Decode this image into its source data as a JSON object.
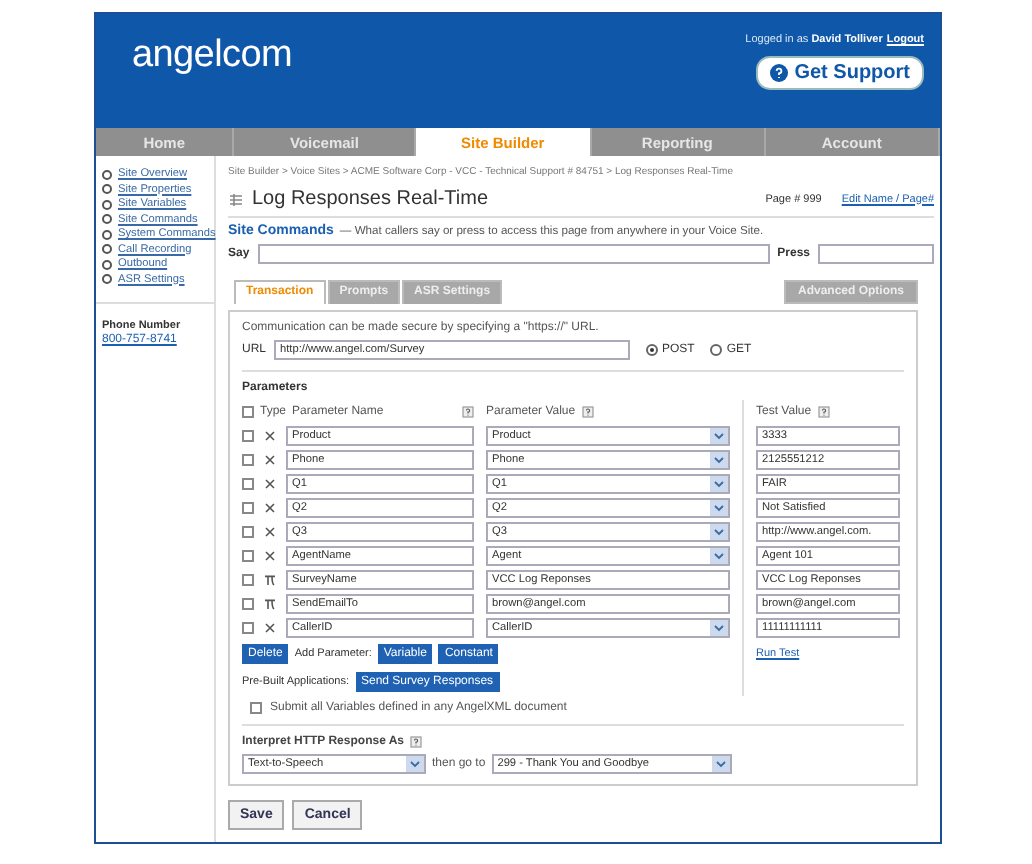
{
  "header": {
    "logo": "angelcom",
    "logged_in_prefix": "Logged in as",
    "user": "David Tolliver",
    "logout": "Logout",
    "support": "Get Support"
  },
  "nav": [
    {
      "label": "Home",
      "selected": false
    },
    {
      "label": "Voicemail",
      "selected": false
    },
    {
      "label": "Site Builder",
      "selected": true
    },
    {
      "label": "Reporting",
      "selected": false
    },
    {
      "label": "Account",
      "selected": false
    }
  ],
  "sidebar": {
    "items": [
      "Site Overview",
      "Site Properties",
      "Site Variables",
      "Site Commands",
      "System Commands",
      "Call Recording",
      "Outbound",
      "ASR Settings"
    ],
    "phone_label": "Phone Number",
    "phone": "800-757-8741"
  },
  "breadcrumb": "Site Builder > Voice Sites > ACME Software Corp - VCC - Technical Support # 84751 > Log Responses Real-Time",
  "page_title": "Log Responses Real-Time",
  "page_number": "Page # 999",
  "edit_link": "Edit Name / Page#",
  "site_commands": {
    "title": "Site Commands",
    "description": "— What callers say or press to access this page from anywhere in your Voice Site.",
    "say_label": "Say",
    "press_label": "Press"
  },
  "tabs": [
    {
      "label": "Transaction",
      "selected": true
    },
    {
      "label": "Prompts",
      "selected": false
    },
    {
      "label": "ASR Settings",
      "selected": false
    }
  ],
  "advanced_options": "Advanced Options",
  "transaction": {
    "secure_note": "Communication can be made secure by specifying a \"https://\" URL.",
    "url_label": "URL",
    "url": "http://www.angel.com/Survey",
    "methods": [
      {
        "label": "POST",
        "selected": true
      },
      {
        "label": "GET",
        "selected": false
      }
    ],
    "parameters_title": "Parameters",
    "select_all_checked": false,
    "type_label": "Type",
    "name_label": "Parameter Name",
    "value_label": "Parameter Value",
    "test_label": "Test Value",
    "rows": [
      {
        "kind": "variable",
        "checked": false,
        "name": "Product",
        "value": "Product",
        "test": "3333"
      },
      {
        "kind": "variable",
        "checked": false,
        "name": "Phone",
        "value": "Phone",
        "test": "2125551212"
      },
      {
        "kind": "variable",
        "checked": false,
        "name": "Q1",
        "value": "Q1",
        "test": "FAIR"
      },
      {
        "kind": "variable",
        "checked": false,
        "name": "Q2",
        "value": "Q2",
        "test": "Not Satisfied"
      },
      {
        "kind": "variable",
        "checked": false,
        "name": "Q3",
        "value": "Q3",
        "test": "http://www.angel.com."
      },
      {
        "kind": "variable",
        "checked": false,
        "name": "AgentName",
        "value": "Agent",
        "test": "Agent 101"
      },
      {
        "kind": "constant",
        "checked": false,
        "name": "SurveyName",
        "value": "VCC Log Reponses",
        "test": "VCC Log Reponses"
      },
      {
        "kind": "constant",
        "checked": false,
        "name": "SendEmailTo",
        "value": "brown@angel.com",
        "test": "brown@angel.com"
      },
      {
        "kind": "variable",
        "checked": false,
        "name": "CallerID",
        "value": "CallerID",
        "test": "11111111111"
      }
    ],
    "delete": "Delete",
    "add_parameter_label": "Add Parameter:",
    "add_buttons": [
      "Variable",
      "Constant"
    ],
    "run_test": "Run Test",
    "prebuilt_label": "Pre-Built Applications:",
    "prebuilt_button": "Send Survey Responses",
    "submit_all": {
      "label": "Submit all Variables defined in any AngelXML document",
      "checked": false
    },
    "interpret_title": "Interpret HTTP Response As",
    "response_type": "Text-to-Speech",
    "goto_label": "then go to",
    "goto_target": "299 - Thank You and Goodbye"
  },
  "buttons": [
    "Save",
    "Cancel"
  ]
}
